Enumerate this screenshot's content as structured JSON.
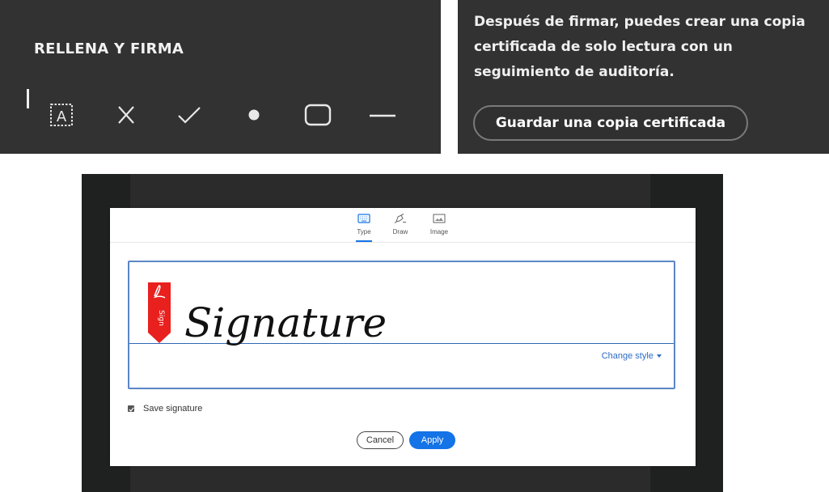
{
  "fill_sign": {
    "title": "RELLENA Y FIRMA",
    "tools": [
      {
        "icon": "text-field-icon",
        "glyph": "A"
      },
      {
        "icon": "cross-mark-icon"
      },
      {
        "icon": "checkmark-icon"
      },
      {
        "icon": "dot-icon"
      },
      {
        "icon": "rounded-rectangle-icon"
      },
      {
        "icon": "line-icon"
      }
    ]
  },
  "certified": {
    "text": "Después de firmar, puedes crear una copia certificada de solo lectura con un seguimiento de auditoría.",
    "button_label": "Guardar una copia certificada"
  },
  "signature_dialog": {
    "tabs": [
      {
        "label": "Type",
        "icon": "keyboard-icon",
        "active": true
      },
      {
        "label": "Draw",
        "icon": "pen-icon",
        "active": false
      },
      {
        "label": "Image",
        "icon": "image-icon",
        "active": false
      }
    ],
    "signature_text": "Signature",
    "ribbon_text": "Sign",
    "change_style_label": "Change style",
    "save_signature_label": "Save signature",
    "save_signature_checked": true,
    "cancel_label": "Cancel",
    "apply_label": "Apply",
    "accent_color": "#1473e6",
    "ribbon_color": "#e8201e"
  }
}
